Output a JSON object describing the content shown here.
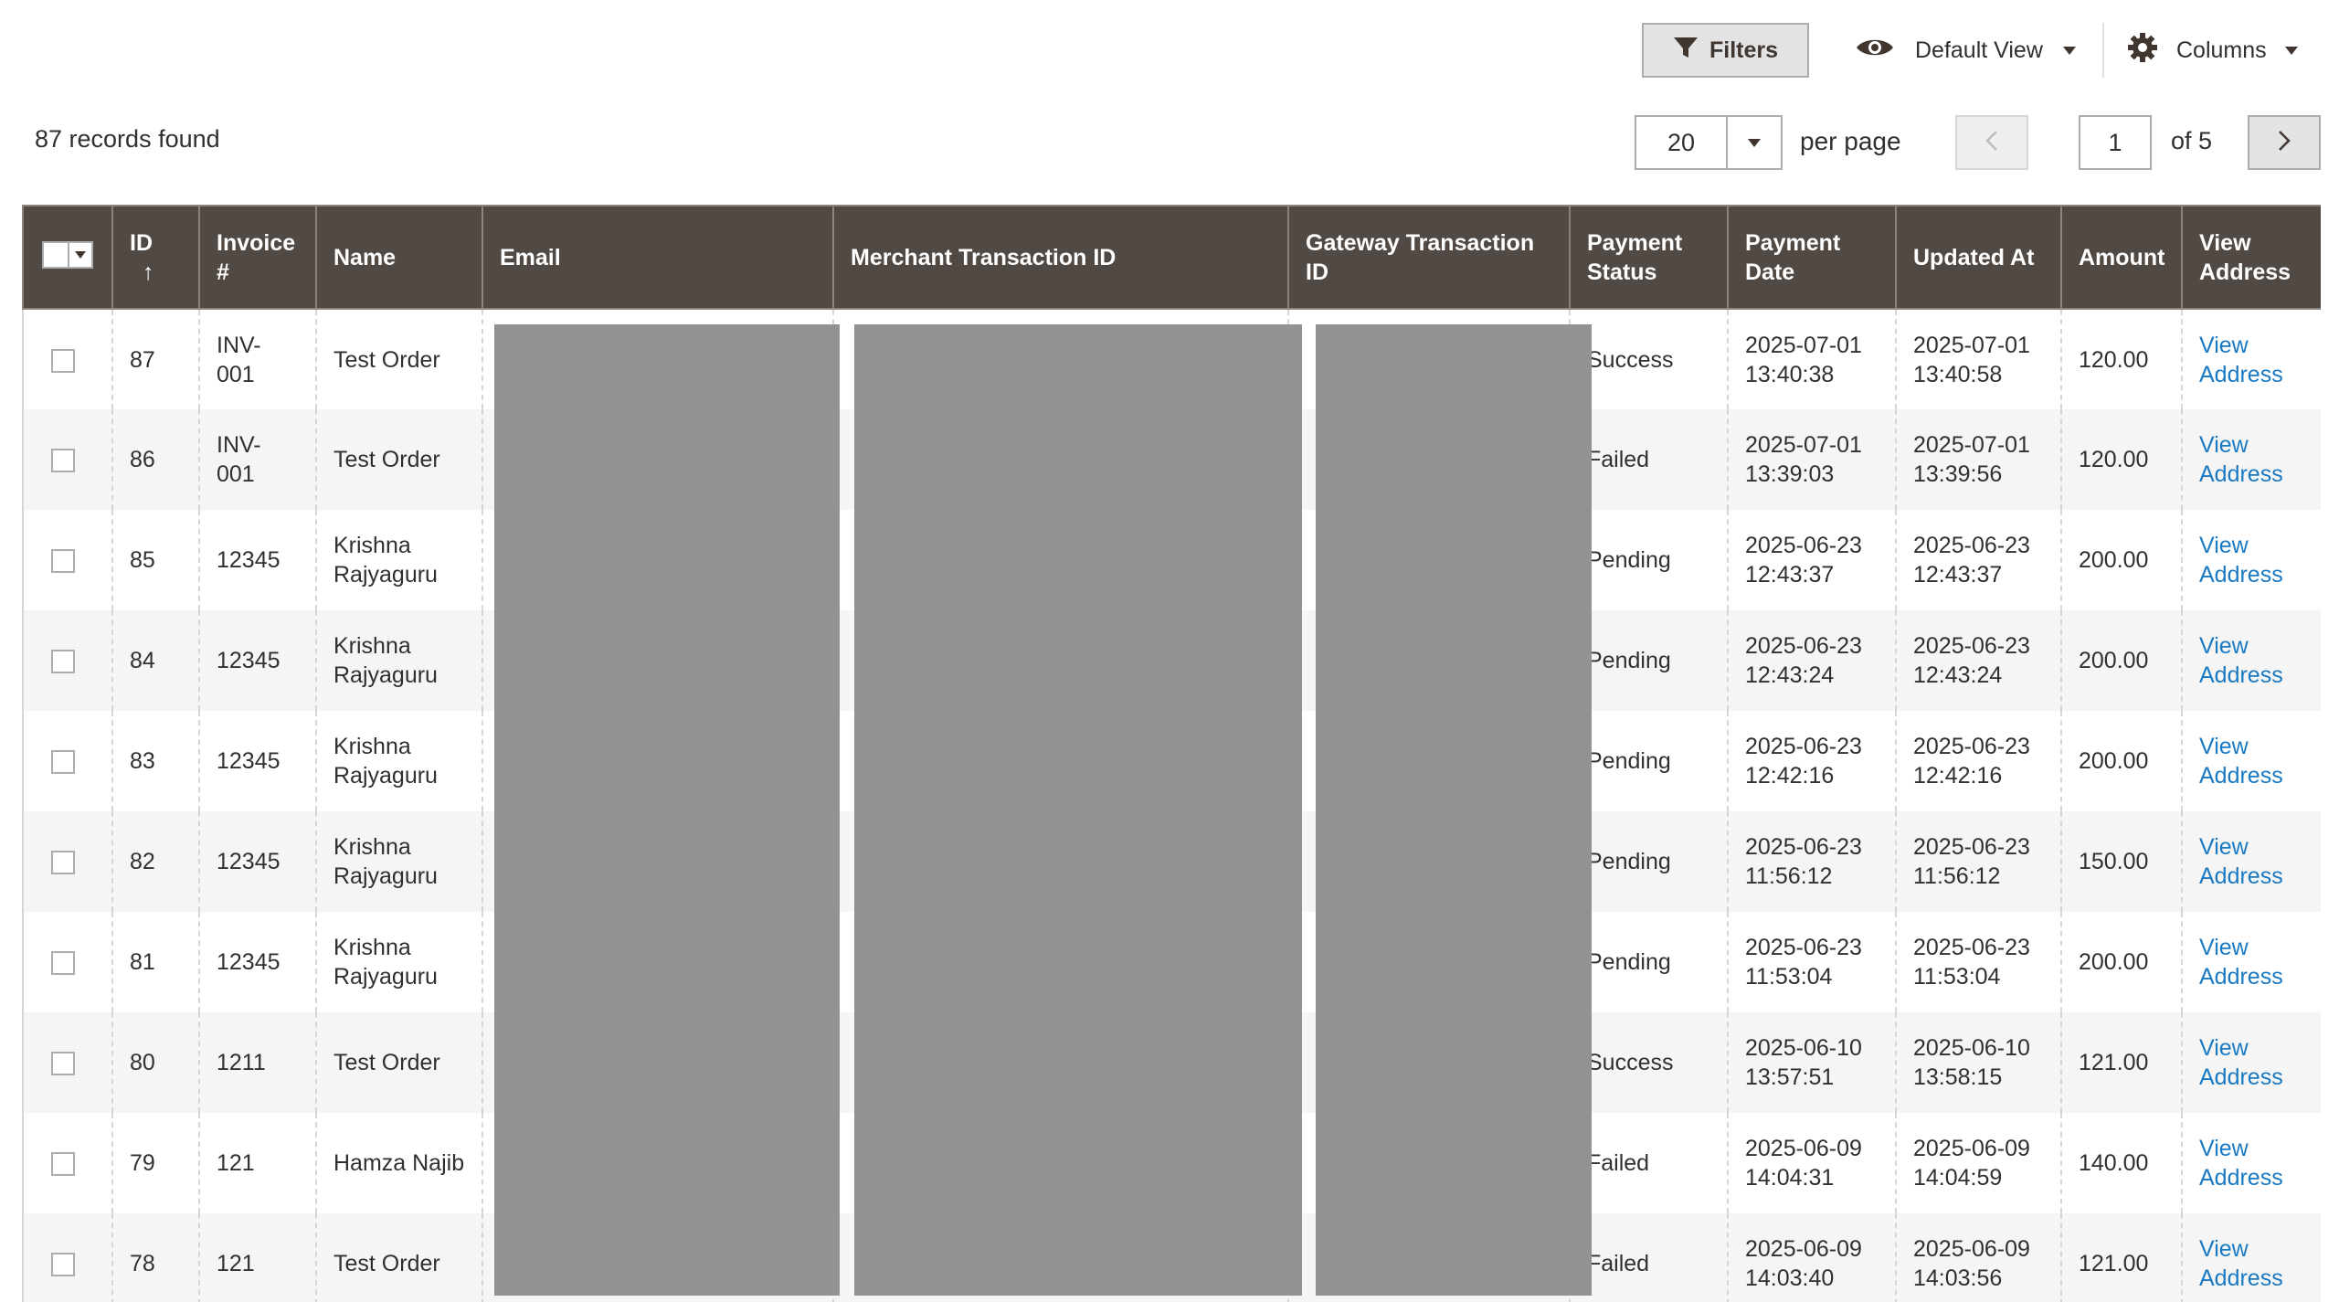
{
  "toolbar": {
    "filters_label": "Filters",
    "view_label": "Default View",
    "columns_label": "Columns"
  },
  "records_found": "87 records found",
  "pagination": {
    "per_page_value": "20",
    "per_page_label": "per page",
    "current_page": "1",
    "of_pages": "of 5"
  },
  "table": {
    "headers": {
      "id": "ID",
      "sort_icon": "↑",
      "invoice": "Invoice #",
      "name": "Name",
      "email": "Email",
      "merchant_txn": "Merchant Transaction ID",
      "gateway_txn": "Gateway Transaction ID",
      "payment_status": "Payment Status",
      "payment_date": "Payment Date",
      "updated_at": "Updated At",
      "amount": "Amount",
      "view_address": "View Address"
    },
    "rows": [
      {
        "id": "87",
        "invoice": "INV-001",
        "name": "Test Order",
        "status": "Success",
        "payment_date": "2025-07-01 13:40:38",
        "updated_at": "2025-07-01 13:40:58",
        "amount": "120.00",
        "link": "View Address"
      },
      {
        "id": "86",
        "invoice": "INV-001",
        "name": "Test Order",
        "status": "Failed",
        "payment_date": "2025-07-01 13:39:03",
        "updated_at": "2025-07-01 13:39:56",
        "amount": "120.00",
        "link": "View Address"
      },
      {
        "id": "85",
        "invoice": "12345",
        "name": "Krishna Rajyaguru",
        "status": "Pending",
        "payment_date": "2025-06-23 12:43:37",
        "updated_at": "2025-06-23 12:43:37",
        "amount": "200.00",
        "link": "View Address"
      },
      {
        "id": "84",
        "invoice": "12345",
        "name": "Krishna Rajyaguru",
        "status": "Pending",
        "payment_date": "2025-06-23 12:43:24",
        "updated_at": "2025-06-23 12:43:24",
        "amount": "200.00",
        "link": "View Address"
      },
      {
        "id": "83",
        "invoice": "12345",
        "name": "Krishna Rajyaguru",
        "status": "Pending",
        "payment_date": "2025-06-23 12:42:16",
        "updated_at": "2025-06-23 12:42:16",
        "amount": "200.00",
        "link": "View Address"
      },
      {
        "id": "82",
        "invoice": "12345",
        "name": "Krishna Rajyaguru",
        "status": "Pending",
        "payment_date": "2025-06-23 11:56:12",
        "updated_at": "2025-06-23 11:56:12",
        "amount": "150.00",
        "link": "View Address"
      },
      {
        "id": "81",
        "invoice": "12345",
        "name": "Krishna Rajyaguru",
        "status": "Pending",
        "payment_date": "2025-06-23 11:53:04",
        "updated_at": "2025-06-23 11:53:04",
        "amount": "200.00",
        "link": "View Address"
      },
      {
        "id": "80",
        "invoice": "1211",
        "name": "Test Order",
        "status": "Success",
        "payment_date": "2025-06-10 13:57:51",
        "updated_at": "2025-06-10 13:58:15",
        "amount": "121.00",
        "link": "View Address"
      },
      {
        "id": "79",
        "invoice": "121",
        "name": "Hamza Najib",
        "status": "Failed",
        "payment_date": "2025-06-09 14:04:31",
        "updated_at": "2025-06-09 14:04:59",
        "amount": "140.00",
        "link": "View Address"
      },
      {
        "id": "78",
        "invoice": "121",
        "name": "Test Order",
        "status": "Failed",
        "payment_date": "2025-06-09 14:03:40",
        "updated_at": "2025-06-09 14:03:56",
        "amount": "121.00",
        "link": "View Address"
      }
    ]
  },
  "colors": {
    "header_bg": "#514943",
    "link": "#1979c3",
    "redacted": "#929292"
  },
  "icons": {
    "filters": "funnel-icon",
    "view": "eye-icon",
    "columns": "gear-icon"
  }
}
